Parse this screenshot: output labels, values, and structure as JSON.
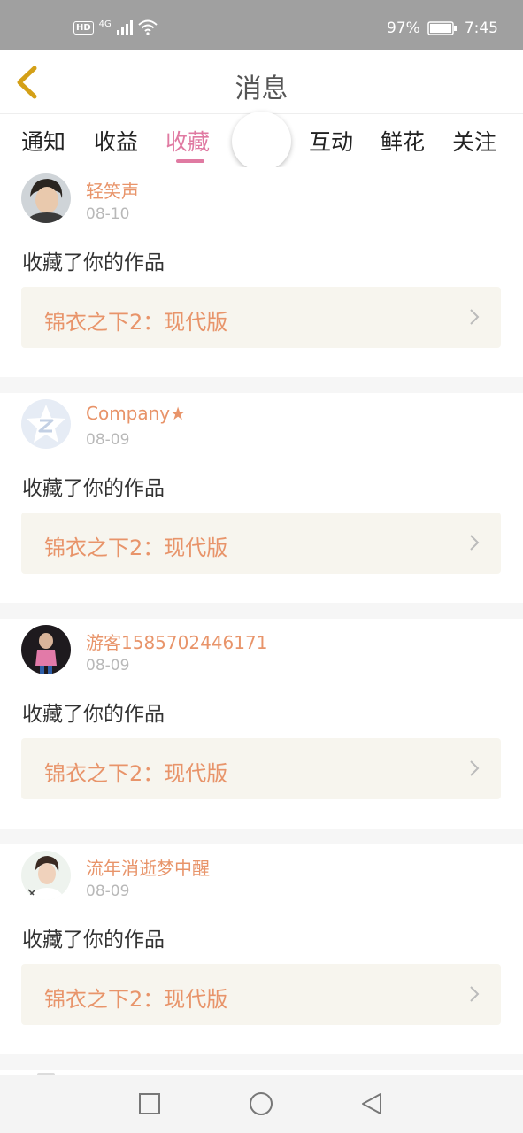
{
  "status": {
    "hd": "HD",
    "net": "4G",
    "battery": "97%",
    "time": "7:45"
  },
  "header": {
    "title": "消息"
  },
  "tabs": [
    {
      "label": "通知"
    },
    {
      "label": "收益"
    },
    {
      "label": "收藏"
    },
    {
      "label": "互动"
    },
    {
      "label": "鲜花"
    },
    {
      "label": "关注"
    }
  ],
  "active_tab": "收藏",
  "items": [
    {
      "name": "轻笑声",
      "date": "08-10",
      "action": "收藏了你的作品",
      "work": "锦衣之下2：现代版"
    },
    {
      "name": "Company★",
      "date": "08-09",
      "action": "收藏了你的作品",
      "work": "锦衣之下2：现代版"
    },
    {
      "name": "游客1585702446171",
      "date": "08-09",
      "action": "收藏了你的作品",
      "work": "锦衣之下2：现代版"
    },
    {
      "name": "流年消逝梦中醒",
      "date": "08-09",
      "action": "收藏了你的作品",
      "work": "锦衣之下2：现代版"
    }
  ],
  "colors": {
    "accent_pink": "#e07aa2",
    "name_orange": "#e8946a",
    "back_arrow": "#d4a017"
  },
  "icons": {
    "back": "chevron-left-icon",
    "item_arrow": "chevron-right-icon",
    "nav": [
      "square-icon",
      "circle-icon",
      "triangle-back-icon"
    ]
  }
}
